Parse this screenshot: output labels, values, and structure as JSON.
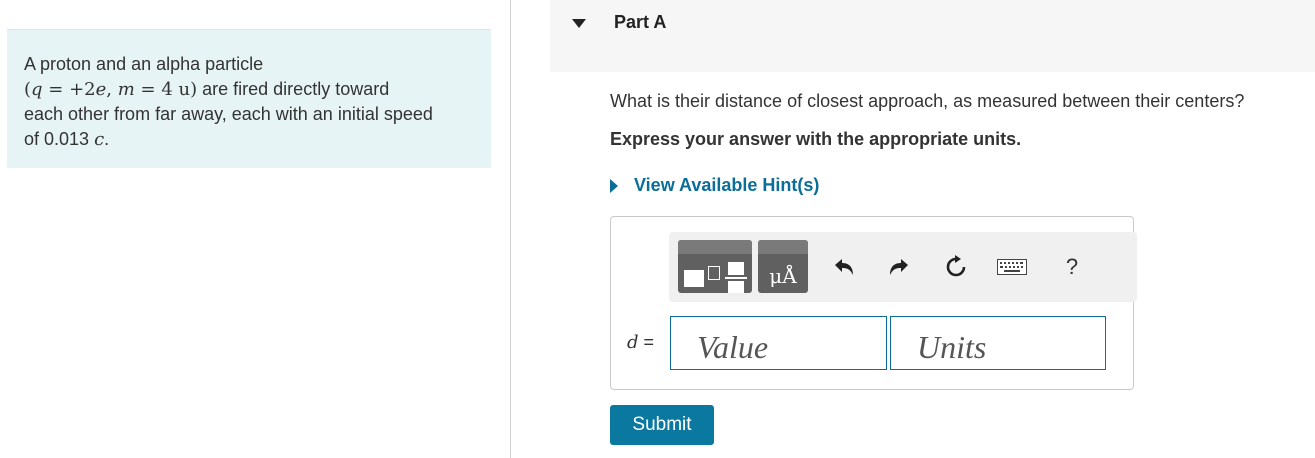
{
  "problem": {
    "line1": "A proton and an alpha particle",
    "math_q": "q",
    "math_eq1": " = +2",
    "math_e": "e",
    "math_comma": ", ",
    "math_m": "m",
    "math_eq2": " = 4 u",
    "line2_rest": " are fired directly toward",
    "line3": "each other from far away, each with an initial speed",
    "line4_pre": "of 0.013 ",
    "line4_c": "c",
    "line4_post": "."
  },
  "part": {
    "title": "Part A"
  },
  "question": "What is their distance of closest approach, as measured between their centers?",
  "instruction": "Express your answer with the appropriate units.",
  "hints_link": "View Available Hint(s)",
  "toolbar": {
    "units_glyph": "μÅ",
    "help": "?",
    "icons": [
      "templates-icon",
      "units-icon",
      "undo-icon",
      "redo-icon",
      "reset-icon",
      "keyboard-icon",
      "help-icon"
    ]
  },
  "answer": {
    "variable": "d",
    "equals": " =",
    "value_placeholder": "Value",
    "units_placeholder": "Units"
  },
  "submit_label": "Submit",
  "colors": {
    "accent": "#0b6e99",
    "submit_bg": "#0b78a0",
    "problem_bg": "#e6f4f5"
  }
}
